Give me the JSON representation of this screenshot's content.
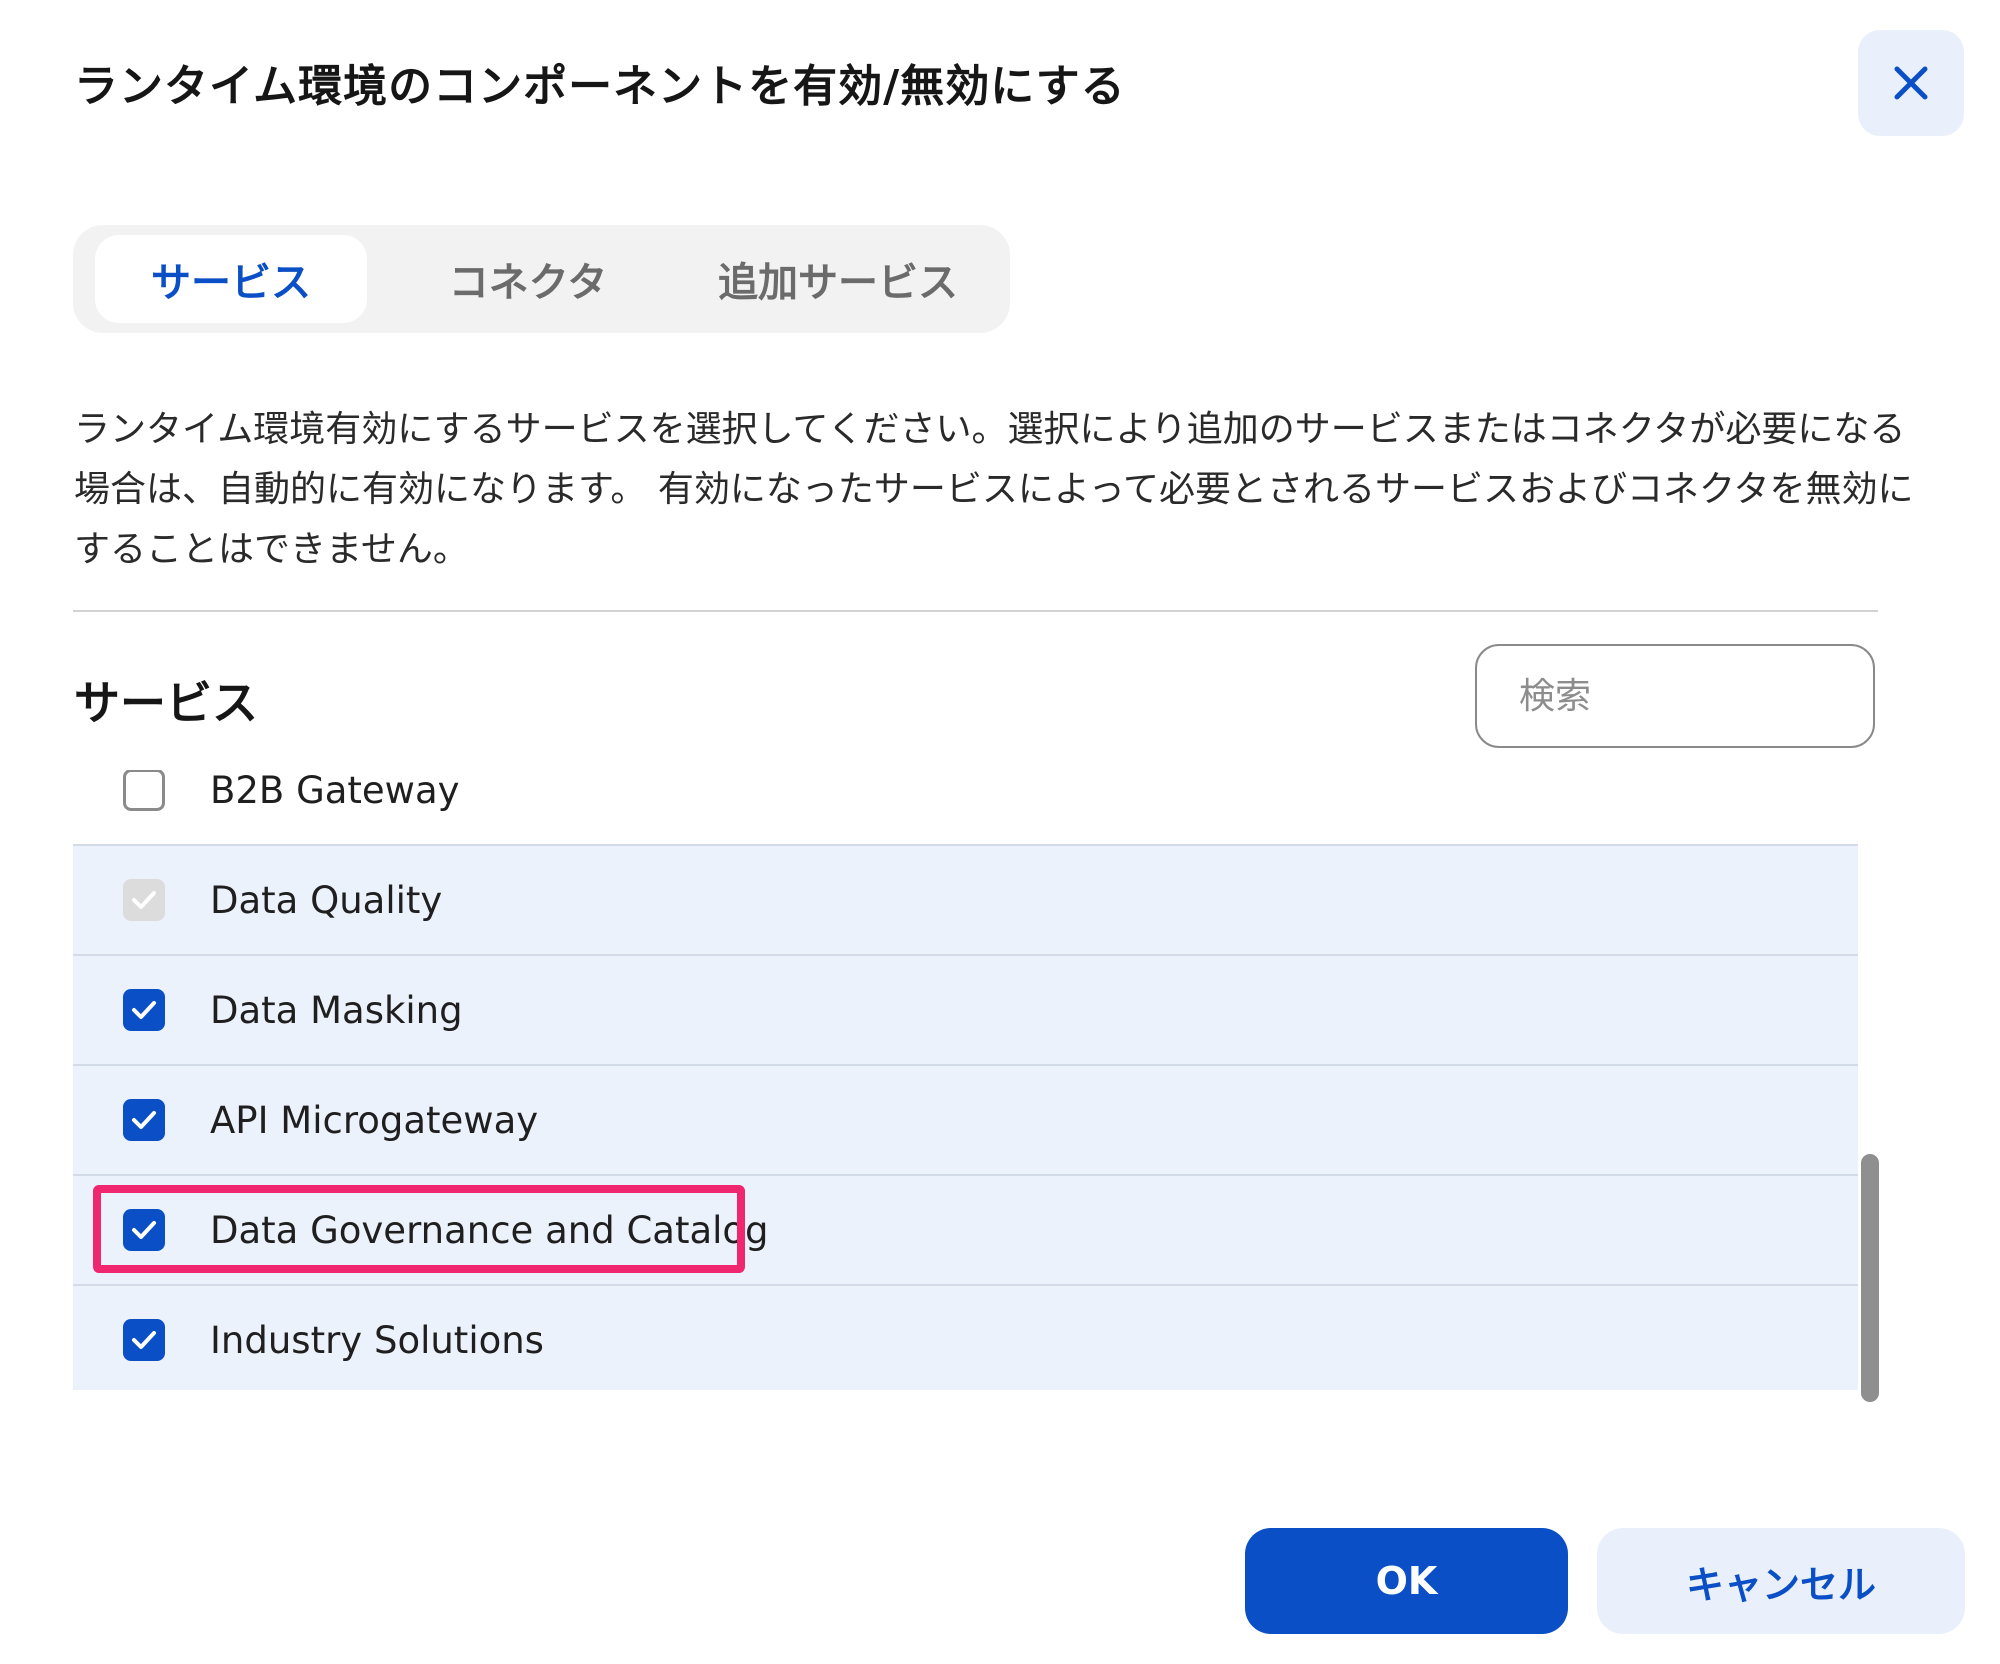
{
  "dialog": {
    "title": "ランタイム環境のコンポーネントを有効/無効にする",
    "close_icon": "close-icon"
  },
  "tabs": [
    {
      "label": "サービス",
      "active": true
    },
    {
      "label": "コネクタ",
      "active": false
    },
    {
      "label": "追加サービス",
      "active": false
    }
  ],
  "description": "ランタイム環境有効にするサービスを選択してください。選択により追加のサービスまたはコネクタが必要になる場合は、自動的に有効になります。 有効になったサービスによって必要とされるサービスおよびコネクタを無効にすることはできません。",
  "section": {
    "title": "サービス",
    "search_placeholder": "検索"
  },
  "services": [
    {
      "label": "B2B Gateway",
      "state": "unchecked"
    },
    {
      "label": "Data Quality",
      "state": "checked-disabled"
    },
    {
      "label": "Data Masking",
      "state": "checked"
    },
    {
      "label": "API Microgateway",
      "state": "checked"
    },
    {
      "label": "Data Governance and Catalog",
      "state": "checked",
      "highlighted": true
    },
    {
      "label": "Industry Solutions",
      "state": "checked"
    }
  ],
  "footer": {
    "ok_label": "OK",
    "cancel_label": "キャンセル"
  },
  "colors": {
    "accent": "#0b4fc6",
    "highlight": "#f0266e",
    "row_selected": "#ecf2fc"
  }
}
